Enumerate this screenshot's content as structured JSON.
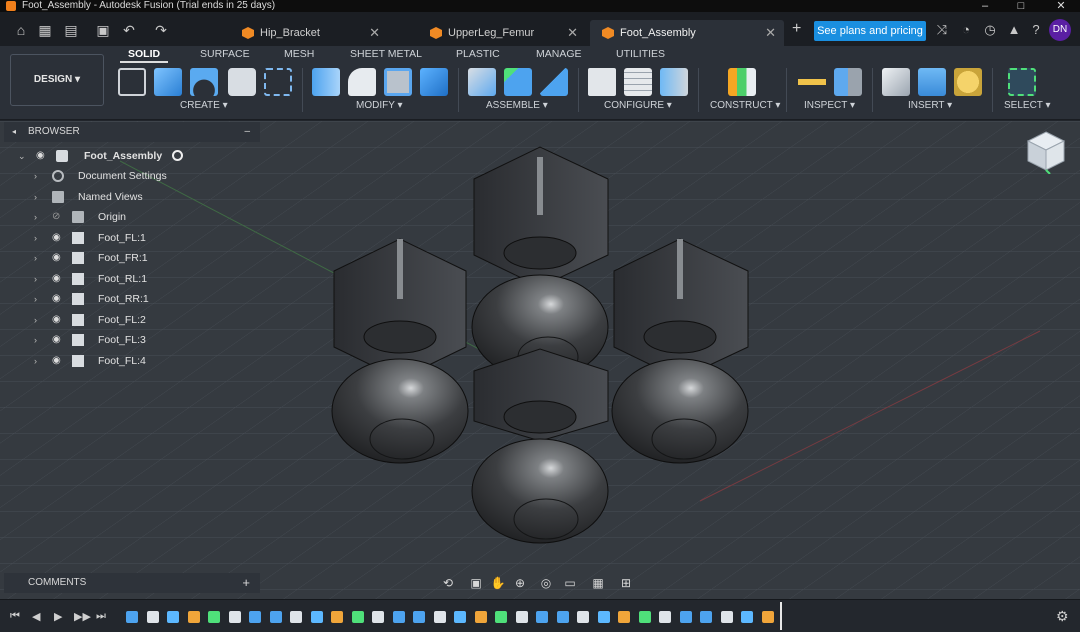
{
  "window": {
    "title": "Foot_Assembly - Autodesk Fusion (Trial ends in 25 days)"
  },
  "quick_access": {
    "home_icon": "home-icon",
    "grid_icon": "grid-icon",
    "file_icon": "file-icon",
    "save_icon": "save-icon",
    "undo_icon": "undo-icon",
    "redo_icon": "redo-icon"
  },
  "tabs": [
    {
      "label": "Hip_Bracket",
      "active": false
    },
    {
      "label": "UpperLeg_Femur",
      "active": false
    },
    {
      "label": "Foot_Assembly",
      "active": true
    }
  ],
  "header": {
    "plans_label": "See plans and pricing",
    "avatar": "DN"
  },
  "toolbar": {
    "design_label": "DESIGN",
    "workspace_tabs": [
      "SOLID",
      "SURFACE",
      "MESH",
      "SHEET METAL",
      "PLASTIC",
      "MANAGE",
      "UTILITIES"
    ],
    "groups": [
      "CREATE",
      "MODIFY",
      "ASSEMBLE",
      "CONFIGURE",
      "CONSTRUCT",
      "INSPECT",
      "INSERT",
      "SELECT"
    ]
  },
  "browser": {
    "title": "BROWSER",
    "root": "Foot_Assembly",
    "items": [
      "Document Settings",
      "Named Views",
      "Origin",
      "Foot_FL:1",
      "Foot_FR:1",
      "Foot_RL:1",
      "Foot_RR:1",
      "Foot_FL:2",
      "Foot_FL:3",
      "Foot_FL:4"
    ]
  },
  "comments": {
    "title": "COMMENTS"
  },
  "colors": {
    "accent": "#1a8fe0",
    "brand_orange": "#f07f1b",
    "avatar": "#5a1fa3",
    "viewport": "#353a40"
  }
}
